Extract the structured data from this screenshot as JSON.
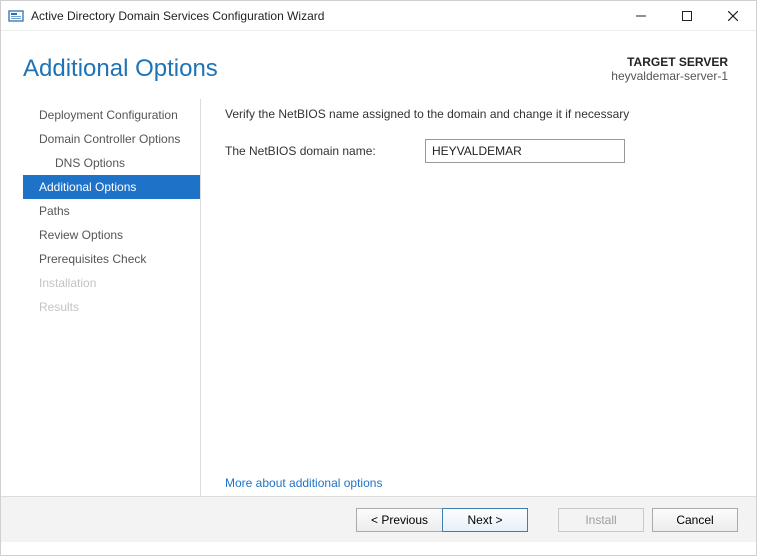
{
  "window": {
    "title": "Active Directory Domain Services Configuration Wizard"
  },
  "header": {
    "title": "Additional Options",
    "target_label": "TARGET SERVER",
    "target_value": "heyvaldemar-server-1"
  },
  "sidebar": {
    "items": [
      {
        "label": "Deployment Configuration",
        "state": "normal"
      },
      {
        "label": "Domain Controller Options",
        "state": "normal"
      },
      {
        "label": "DNS Options",
        "state": "sub"
      },
      {
        "label": "Additional Options",
        "state": "selected"
      },
      {
        "label": "Paths",
        "state": "normal"
      },
      {
        "label": "Review Options",
        "state": "normal"
      },
      {
        "label": "Prerequisites Check",
        "state": "normal"
      },
      {
        "label": "Installation",
        "state": "disabled"
      },
      {
        "label": "Results",
        "state": "disabled"
      }
    ]
  },
  "main": {
    "description": "Verify the NetBIOS name assigned to the domain and change it if necessary",
    "netbios_label": "The NetBIOS domain name:",
    "netbios_value": "HEYVALDEMAR",
    "more_link": "More about additional options"
  },
  "footer": {
    "previous": "< Previous",
    "next": "Next >",
    "install": "Install",
    "cancel": "Cancel"
  }
}
